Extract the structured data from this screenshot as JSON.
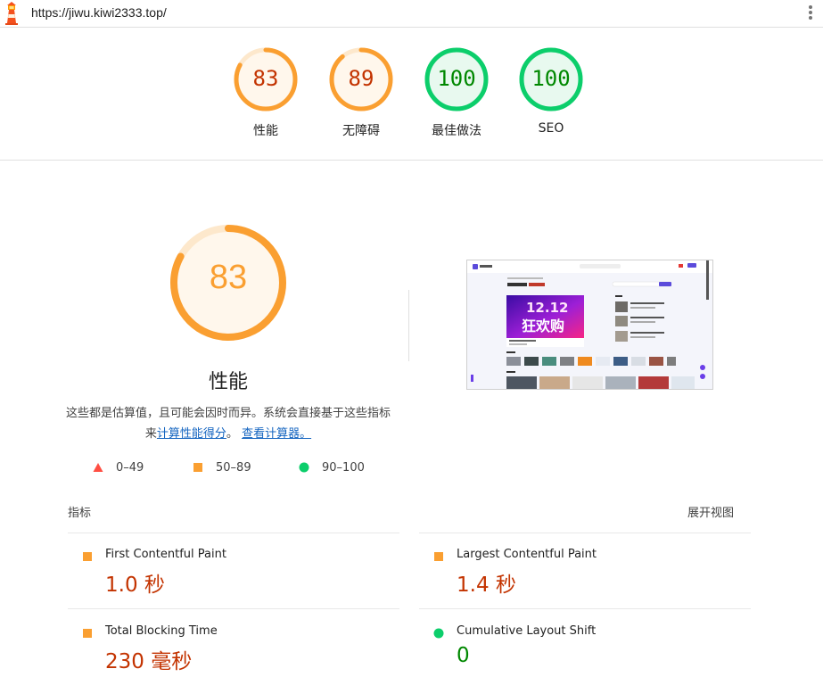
{
  "url": "https://jiwu.kiwi2333.top/",
  "colors": {
    "average": "#fa9f31",
    "pass": "#0cce6b",
    "fail": "#ff4e42",
    "average_text": "#c33300",
    "pass_text": "#008800"
  },
  "categories": [
    {
      "score": "83",
      "label": "性能",
      "rating": "average",
      "value": 0.83
    },
    {
      "score": "89",
      "label": "无障碍",
      "rating": "average",
      "value": 0.89
    },
    {
      "score": "100",
      "label": "最佳做法",
      "rating": "pass",
      "value": 1.0
    },
    {
      "score": "100",
      "label": "SEO",
      "rating": "pass",
      "value": 1.0
    }
  ],
  "performance": {
    "score": "83",
    "value": 0.83,
    "title": "性能",
    "desc_text": "这些都是估算值，且可能会因时而异。系统会直接基于这些指标来",
    "link1": "计算性能得分",
    "sep": "。",
    "link2": "查看计算器。"
  },
  "legend": [
    {
      "shape": "triangle",
      "range": "0–49"
    },
    {
      "shape": "square",
      "range": "50–89"
    },
    {
      "shape": "circle",
      "range": "90–100"
    }
  ],
  "metrics_header": "指标",
  "expand_label": "展开视图",
  "metrics": [
    {
      "name": "First Contentful Paint",
      "value": "1.0 秒",
      "rating": "average"
    },
    {
      "name": "Largest Contentful Paint",
      "value": "1.4 秒",
      "rating": "average"
    },
    {
      "name": "Total Blocking Time",
      "value": "230 毫秒",
      "rating": "average"
    },
    {
      "name": "Cumulative Layout Shift",
      "value": "0",
      "rating": "pass"
    }
  ],
  "thumbnail": {
    "date_text": "12.12",
    "banner_text": "狂欢购"
  }
}
